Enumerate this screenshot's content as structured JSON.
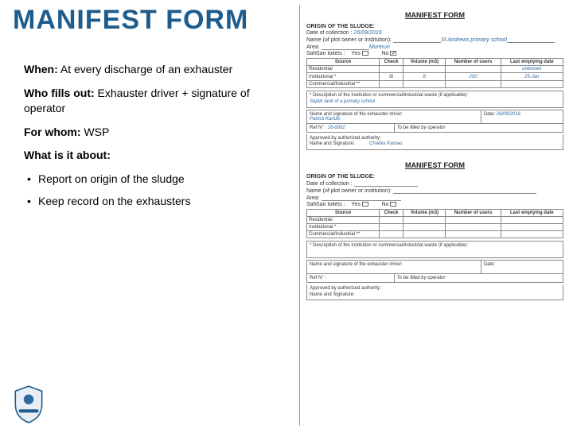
{
  "title": "MANIFEST FORM",
  "left": {
    "when_label": "When:",
    "when_text": " At every discharge of an exhauster",
    "who_label": "Who fills out:",
    "who_text": " Exhauster driver + signature of operator",
    "forwhom_label": "For whom:",
    "forwhom_text": " WSP",
    "what_label": "What is it about:",
    "bullets": [
      "Report on origin of the sludge",
      "Keep record on the exhausters"
    ]
  },
  "form": {
    "title": "MANIFEST FORM",
    "origin_head": "ORIGIN OF THE SLUDGE:",
    "date_label": "Date of collection :",
    "name_label": "Name (of plot owner or institution): ",
    "area_label": "Area:",
    "toilets_label": "SafiSan toilets :",
    "yes": "Yes",
    "no": "No",
    "table": {
      "headers": [
        "Source",
        "Check",
        "Volume (m3)",
        "Number of users",
        "Last emptying date"
      ],
      "rows_labels": [
        "Residential",
        "Institutional *",
        "Commercial/Industrial **"
      ]
    },
    "desc_label": "* Description of the institution or commercial/industrial waste (if applicable):",
    "driver_label": "Name and signature of the exhauster driver:",
    "date2_label": "Date:",
    "ref_label": "Ref N° :",
    "ref_hint": "To be filled by operator",
    "approved_label": "Approved by authorized authority:",
    "namesig_label": "Name and Signature:",
    "filled": {
      "date": "26/09/2016",
      "name": "St Andrews primary school",
      "area": "Mureruri",
      "toilet_yes": false,
      "toilet_no": true,
      "rows": [
        {
          "check": "",
          "vol": "",
          "users": "",
          "last": ""
        },
        {
          "check": "☒",
          "vol": "8",
          "users": "250",
          "last": "25-Jan"
        },
        {
          "check": "",
          "vol": "",
          "users": "",
          "last": "unknown"
        }
      ],
      "desc": "Septic tank of a primary school",
      "driver": "Patrick Kariuki",
      "date2": "26/09/2016",
      "ref": "16-0002",
      "approved_name": "Charles Kamau"
    }
  }
}
